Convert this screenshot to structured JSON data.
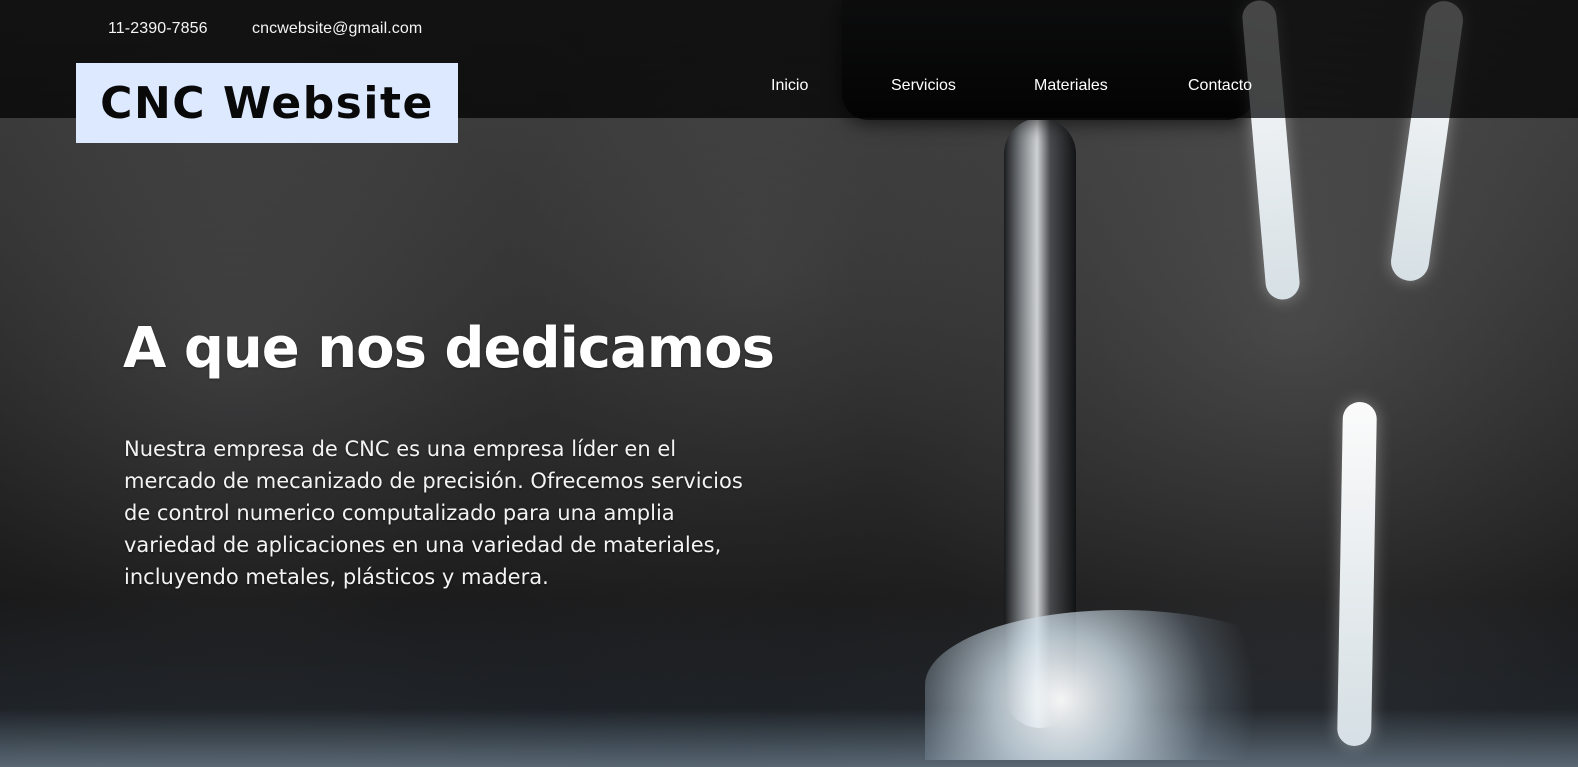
{
  "header": {
    "phone": "11-2390-7856",
    "email": "cncwebsite@gmail.com",
    "brand": "CNC Website",
    "nav": [
      "Inicio",
      "Servicios",
      "Materiales",
      "Contacto"
    ]
  },
  "hero": {
    "title": "A que nos dedicamos",
    "paragraph": "Nuestra empresa de CNC es una empresa líder en el mercado de mecanizado de precisión. Ofrecemos servicios de control numerico computalizado para una amplia variedad de aplicaciones en una variedad de materiales, incluyendo metales, plásticos y madera."
  },
  "colors": {
    "brand_background": "#dce9ff",
    "header_overlay": "#000000",
    "text_primary": "#ffffff"
  }
}
